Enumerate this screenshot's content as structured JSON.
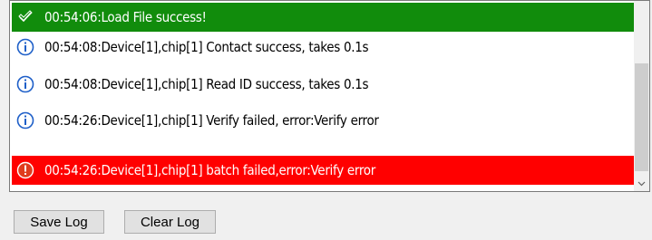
{
  "log": {
    "entries": [
      {
        "type": "success",
        "icon": "check-icon",
        "text": "00:54:06:Load File success!"
      },
      {
        "type": "info",
        "icon": "info-icon",
        "text": "00:54:08:Device[1],chip[1] Contact success, takes 0.1s"
      },
      {
        "type": "info",
        "icon": "info-icon",
        "text": "00:54:08:Device[1],chip[1] Read ID success, takes 0.1s"
      },
      {
        "type": "info",
        "icon": "info-icon",
        "text": "00:54:26:Device[1],chip[1] Verify failed, error:Verify error"
      },
      {
        "type": "error",
        "icon": "error-icon",
        "text": "00:54:26:Device[1],chip[1] batch failed,error:Verify error"
      }
    ]
  },
  "buttons": {
    "save_log": "Save Log",
    "clear_log": "Clear Log"
  },
  "colors": {
    "success": "#118c0c",
    "error": "#ff0000",
    "info_icon": "#1e5fc8"
  }
}
